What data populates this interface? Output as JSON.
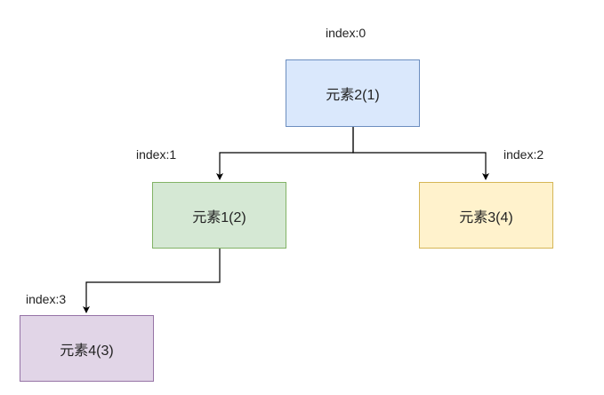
{
  "tree": {
    "nodes": [
      {
        "id": "n0",
        "label": "元素2(1)",
        "index_label": "index:0",
        "fill": "#dae8fc",
        "stroke": "#6c8ebf"
      },
      {
        "id": "n1",
        "label": "元素1(2)",
        "index_label": "index:1",
        "fill": "#d5e8d4",
        "stroke": "#82b366"
      },
      {
        "id": "n2",
        "label": "元素3(4)",
        "index_label": "index:2",
        "fill": "#fff2cc",
        "stroke": "#d6b656"
      },
      {
        "id": "n3",
        "label": "元素4(3)",
        "index_label": "index:3",
        "fill": "#e1d5e7",
        "stroke": "#9673a6"
      }
    ],
    "edges": [
      {
        "from": "n0",
        "to": "n1"
      },
      {
        "from": "n0",
        "to": "n2"
      },
      {
        "from": "n1",
        "to": "n3"
      }
    ]
  }
}
